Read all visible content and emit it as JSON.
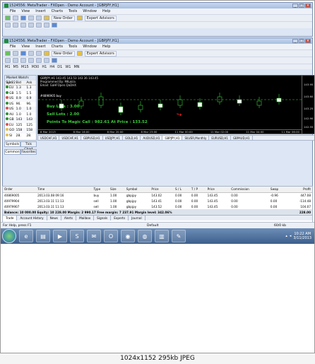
{
  "outer_window": {
    "title": "1524556: MetaTrader - FXOpen - Demo Account - [GBPJPY,H1]",
    "menu": [
      "File",
      "View",
      "Insert",
      "Charts",
      "Tools",
      "Window",
      "Help"
    ],
    "new_order": "New Order",
    "expert_advisors": "Expert Advisors"
  },
  "inner_window": {
    "title": "1524556: MetaTrader - FXOpen - Demo Account - [GBPJPY,H1]",
    "menu": [
      "File",
      "View",
      "Insert",
      "Charts",
      "Tools",
      "Window",
      "Help"
    ],
    "new_order": "New Order",
    "expert_advisors": "Expert Advisors",
    "timeframes": [
      "M1",
      "M5",
      "M15",
      "M30",
      "H1",
      "H4",
      "D1",
      "W1",
      "MN"
    ]
  },
  "market_watch": {
    "header": "Market Watch: 11:22",
    "columns": [
      "Sym",
      "Bid",
      "Ask"
    ],
    "rows": [
      {
        "sym": "EU",
        "bid": "1.3",
        "ask": "1.3",
        "dot": "#2f8f2f"
      },
      {
        "sym": "GB",
        "bid": "1.5",
        "ask": "1.5",
        "dot": "#2f8f2f"
      },
      {
        "sym": "US",
        "bid": "0.9",
        "ask": "0.9",
        "dot": "#d9534f"
      },
      {
        "sym": "US",
        "bid": "96.",
        "ask": "96.",
        "dot": "#2f8f2f"
      },
      {
        "sym": "US",
        "bid": "1.0",
        "ask": "1.0",
        "dot": "#d9534f"
      },
      {
        "sym": "AU",
        "bid": "1.0",
        "ask": "1.0",
        "dot": "#2f8f2f"
      },
      {
        "sym": "GB",
        "bid": "143",
        "ask": "143",
        "dot": "#2f8f2f"
      },
      {
        "sym": "EU",
        "bid": "125",
        "ask": "125",
        "dot": "#d9534f"
      },
      {
        "sym": "GO",
        "bid": "158",
        "ask": "158",
        "dot": "#e3c04a"
      },
      {
        "sym": "SI",
        "bid": "28.",
        "ask": "28.",
        "dot": "#e3c04a"
      }
    ],
    "tabs": [
      "Symbols",
      "Tick Chart"
    ]
  },
  "navigator": {
    "tabs": [
      "Common",
      "Favorites"
    ]
  },
  "chart": {
    "title": "GBPJPY,H1  143.45 143.53 143.36 143.45",
    "info_lines": [
      "Programmed By: MKukila",
      "Email: GaHFOpen.QaDHX",
      "www.privatetra.in.n"
    ],
    "ea_label": "#4896905 buy",
    "buy_lots": "Buy Lots : 3.00",
    "sell_lots": "Sell Lots : 2.00",
    "magic": "Points To Magic Call : 982.61 At Price : 133.52",
    "price_ticks": [
      "143.95",
      "143.60",
      "143.25",
      "142.90",
      "142.55"
    ],
    "time_ticks": [
      "8 Mar 2013",
      "8 Mar 16:00",
      "8 Mar 20:00",
      "8 Mar 23:00",
      "11 Mar 00:00",
      "11 Mar 02:00",
      "11 Mar 04:00",
      "11 Mar 06:00"
    ],
    "tabs": [
      "USDCHF,H1",
      "USDCHF,H1",
      "GBPUSD,H1",
      "USDJPY,H1",
      "GOLD,H1",
      "AUDUSD,H1",
      "GBPJPY,H1",
      "SILVER,Monthly",
      "EURUSD,H1",
      "GBPAUD,H1"
    ],
    "active_tab": "GBPJPY,H1"
  },
  "terminal": {
    "columns": [
      "Order",
      "Time",
      "Type",
      "Size",
      "Symbol",
      "Price",
      "S / L",
      "T / P",
      "Price",
      "Commission",
      "Swap",
      "Profit"
    ],
    "orders": [
      {
        "order": "40869005",
        "time": "2013.03.08 09:16",
        "type": "buy",
        "size": "1.00",
        "symbol": "gbpjpy",
        "price": "143.02",
        "sl": "0.00",
        "tp": "0.00",
        "cur": "143.45",
        "commission": "0.00",
        "swap": "-0.96",
        "profit": "447.08"
      },
      {
        "order": "40979904",
        "time": "2013.03.11 11:13",
        "type": "sell",
        "size": "1.00",
        "symbol": "gbpjpy",
        "price": "143.41",
        "sl": "0.00",
        "tp": "0.00",
        "cur": "143.45",
        "commission": "0.00",
        "swap": "0.00",
        "profit": "-114.48"
      },
      {
        "order": "40979907",
        "time": "2013.03.11 11:13",
        "type": "sell",
        "size": "1.00",
        "symbol": "gbpjpy",
        "price": "143.52",
        "sl": "0.00",
        "tp": "0.00",
        "cur": "143.45",
        "commission": "0.00",
        "swap": "0.00",
        "profit": "104.07"
      }
    ],
    "balance_line": "Balance: 10 000.00  Equity: 10 228.00  Margin: 2 990.17  Free margin: 7 237.91  Margin level: 342.06%",
    "balance_profit": "228.00",
    "tabs": [
      "Trade",
      "Account History",
      "News",
      "Alerts",
      "Mailbox",
      "Signals",
      "Experts",
      "Journal"
    ]
  },
  "status": {
    "help": "For Help, press F1",
    "profile": "Default",
    "traffic": "60/0 kb"
  },
  "taskbar": {
    "time": "10:22 AM",
    "date": "3/11/2013"
  },
  "footer": "1024x1152  295kb  JPEG"
}
